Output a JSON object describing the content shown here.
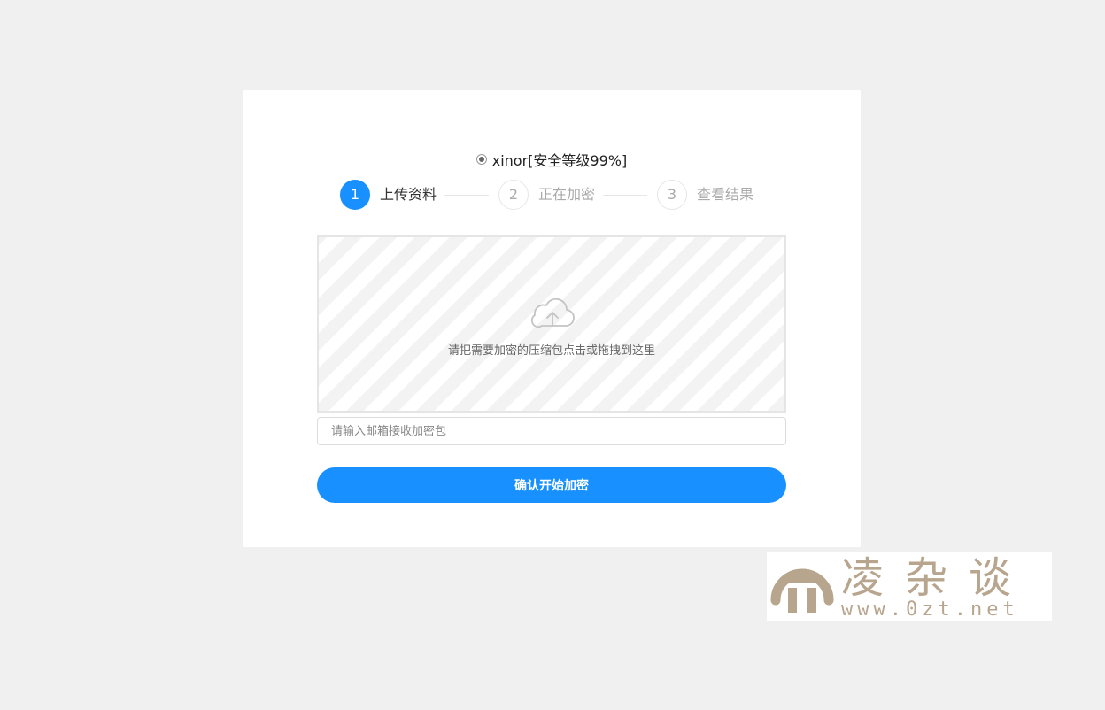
{
  "algorithm": {
    "label": "xinor[安全等级99%]",
    "selected": true
  },
  "steps": [
    {
      "number": "1",
      "label": "上传资料",
      "active": true
    },
    {
      "number": "2",
      "label": "正在加密",
      "active": false
    },
    {
      "number": "3",
      "label": "查看结果",
      "active": false
    }
  ],
  "upload": {
    "hint": "请把需要加密的压缩包点击或拖拽到这里",
    "icon": "cloud-upload-icon"
  },
  "email": {
    "placeholder": "请输入邮箱接收加密包",
    "value": ""
  },
  "submit": {
    "label": "确认开始加密"
  },
  "watermark": {
    "title": "凌杂谈",
    "url": "www.0zt.net"
  },
  "colors": {
    "accent": "#1890ff",
    "background": "#f0f0f0",
    "watermark": "#b7a58d"
  }
}
